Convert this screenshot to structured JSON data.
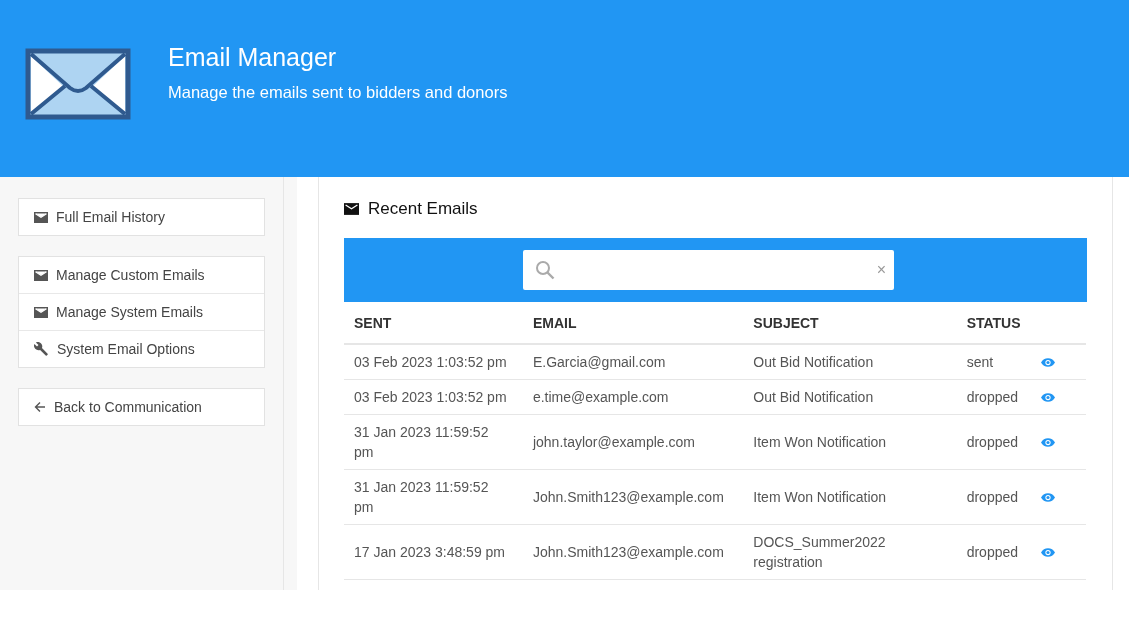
{
  "header": {
    "title": "Email Manager",
    "subtitle": "Manage the emails sent to bidders and donors"
  },
  "sidebar": {
    "groups": [
      [
        {
          "label": "Full Email History",
          "kind": "mail"
        }
      ],
      [
        {
          "label": "Manage Custom Emails",
          "kind": "mail"
        },
        {
          "label": "Manage System Emails",
          "kind": "mail"
        },
        {
          "label": "System Email Options",
          "kind": "wrench"
        }
      ],
      [
        {
          "label": "Back to Communication",
          "kind": "back"
        }
      ]
    ]
  },
  "panel": {
    "title": "Recent Emails",
    "search": {
      "clear": "×"
    },
    "table": {
      "columns": [
        "SENT",
        "EMAIL",
        "SUBJECT",
        "STATUS"
      ],
      "rows": [
        {
          "sent": "03 Feb 2023 1:03:52 pm",
          "email": "E.Garcia@gmail.com",
          "subject": "Out Bid Notification",
          "status": "sent"
        },
        {
          "sent": "03 Feb 2023 1:03:52 pm",
          "email": "e.time@example.com",
          "subject": "Out Bid Notification",
          "status": "dropped"
        },
        {
          "sent": "31 Jan 2023 11:59:52 pm",
          "email": "john.taylor@example.com",
          "subject": "Item Won Notification",
          "status": "dropped"
        },
        {
          "sent": "31 Jan 2023 11:59:52 pm",
          "email": "John.Smith123@example.com",
          "subject": "Item Won Notification",
          "status": "dropped"
        },
        {
          "sent": "17 Jan 2023 3:48:59 pm",
          "email": "John.Smith123@example.com",
          "subject": "DOCS_Summer2022 registration",
          "status": "dropped"
        }
      ]
    }
  }
}
